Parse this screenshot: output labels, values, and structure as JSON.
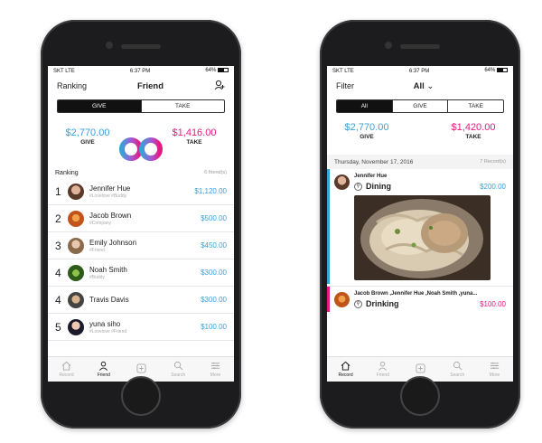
{
  "status": {
    "carrier": "SKT",
    "network": "LTE",
    "time": "6:37 PM",
    "battery": "64%"
  },
  "colors": {
    "give": "#3aa0d8",
    "take": "#e8177e"
  },
  "left": {
    "nav": {
      "left_label": "Ranking",
      "title": "Friend",
      "right_icon": "add-friend-icon"
    },
    "segments": [
      "GIVE",
      "TAKE"
    ],
    "summary": {
      "give_amount": "$2,770.00",
      "give_label": "GIVE",
      "take_amount": "$1,416.00",
      "take_label": "TAKE"
    },
    "ranking": {
      "label": "Ranking",
      "count": "6 friend(s)"
    },
    "rows": [
      {
        "rank": "1",
        "name": "Jennifer Hue",
        "tags": "#Lovelove #Buddy",
        "amount": "$1,120.00"
      },
      {
        "rank": "2",
        "name": "Jacob Brown",
        "tags": "#Company",
        "amount": "$500.00"
      },
      {
        "rank": "3",
        "name": "Emily Johnson",
        "tags": "#Friend",
        "amount": "$450.00"
      },
      {
        "rank": "4",
        "name": "Noah Smith",
        "tags": "#Buddy",
        "amount": "$300.00"
      },
      {
        "rank": "4",
        "name": "Travis Davis",
        "tags": "",
        "amount": "$300.00"
      },
      {
        "rank": "5",
        "name": "yuna siho",
        "tags": "#Lovelove #Friend",
        "amount": "$100.00"
      }
    ]
  },
  "right": {
    "nav": {
      "left_label": "Filter",
      "title": "All"
    },
    "segments": [
      "All",
      "GIVE",
      "TAKE"
    ],
    "summary": {
      "give_amount": "$2,770.00",
      "give_label": "GIVE",
      "take_amount": "$1,420.00",
      "take_label": "TAKE"
    },
    "date": {
      "label": "Thursday, November 17, 2016",
      "count": "7 Record(s)"
    },
    "records": [
      {
        "who": "Jennifer Hue",
        "category": "Dining",
        "amount": "$200.00",
        "kind": "give"
      },
      {
        "who": "Jacob Brown ,Jennifer Hue ,Noah Smith ,yuna...",
        "category": "Drinking",
        "amount": "$100.00",
        "kind": "take"
      }
    ]
  },
  "tabs": [
    "Record",
    "Friend",
    "",
    "Search",
    "More"
  ]
}
